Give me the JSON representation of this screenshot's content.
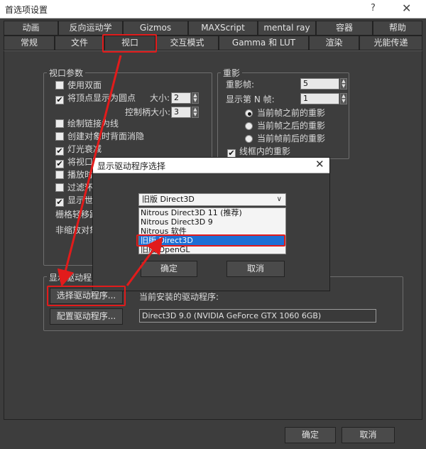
{
  "window": {
    "title": "首选项设置",
    "help": "?",
    "close": "✕"
  },
  "tabs_row1": [
    "动画",
    "反向运动学",
    "Gizmos",
    "MAXScript",
    "mental ray",
    "容器",
    "帮助"
  ],
  "tabs_row2": [
    "常规",
    "文件",
    "视口",
    "交互模式",
    "Gamma 和 LUT",
    "渲染",
    "光能传递"
  ],
  "viewport_params": {
    "title": "视口参数",
    "items": [
      {
        "label": "使用双面",
        "checked": false
      },
      {
        "label": "将顶点显示为圆点",
        "checked": true
      },
      {
        "label": "绘制链接为线",
        "checked": false
      },
      {
        "label": "创建对象时背面消隐",
        "checked": false
      },
      {
        "label": "灯光衰减",
        "checked": true
      },
      {
        "label": "将视口",
        "checked": true
      },
      {
        "label": "播放时",
        "checked": false
      },
      {
        "label": "过滤环",
        "checked": false
      },
      {
        "label": "显示世",
        "checked": true
      }
    ],
    "size_label": "大小:",
    "size_value": "2",
    "handle_size_label": "控制柄大小:",
    "handle_size_value": "3",
    "grid_label": "栅格轻移距",
    "nonscale_label": "非缩放对象"
  },
  "ghosting": {
    "title": "重影",
    "frames_label": "重影帧:",
    "frames_value": "5",
    "nth_label": "显示第 N 帧:",
    "nth_value": "1",
    "radios": [
      {
        "label": "当前帧之前的重影",
        "on": true
      },
      {
        "label": "当前帧之后的重影",
        "on": false
      },
      {
        "label": "当前帧前后的重影",
        "on": false
      }
    ],
    "wireframe_label": "线框内的重影",
    "wireframe_checked": true
  },
  "display_drivers": {
    "title": "显示驱动程序",
    "choose_btn": "选择驱动程序...",
    "configure_btn": "配置驱动程序...",
    "installed_label": "当前安装的驱动程序:",
    "installed_value": "Direct3D 9.0 (NVIDIA GeForce GTX 1060 6GB)"
  },
  "footer": {
    "ok": "确定",
    "cancel": "取消"
  },
  "dialog": {
    "title": "显示驱动程序选择",
    "close": "✕",
    "selected": "旧版 Direct3D",
    "options": [
      "Nitrous Direct3D 11 (推荐)",
      "Nitrous Direct3D 9",
      "Nitrous 软件",
      "旧版 Direct3D",
      "旧版 OpenGL"
    ],
    "ok": "确定",
    "cancel": "取消"
  },
  "colors": {
    "background": "#3d3d3d",
    "highlight": "#1e6fd4",
    "annotation": "#e21b1b"
  }
}
